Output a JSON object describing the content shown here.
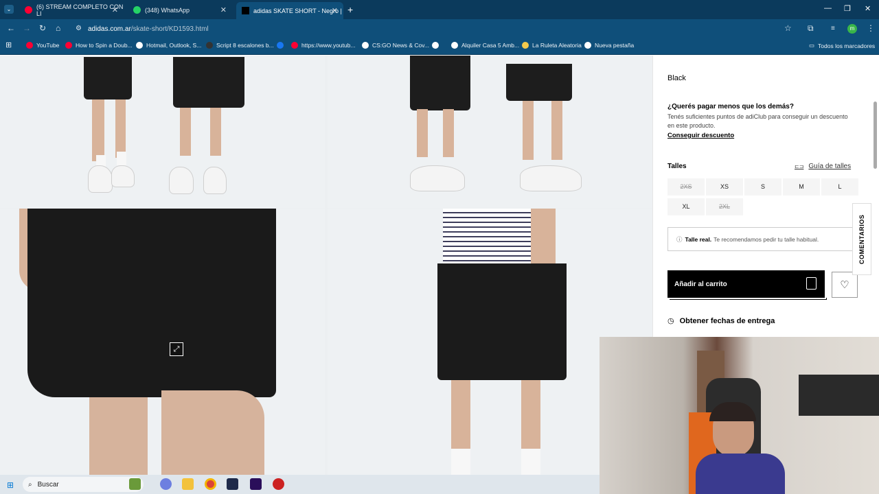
{
  "browser": {
    "tabs": [
      {
        "title": "(6) STREAM COMPLETO CON LI",
        "favicon_color": "#ff0033"
      },
      {
        "title": "(348) WhatsApp",
        "favicon_color": "#25d366"
      },
      {
        "title": "adidas SKATE SHORT - Negro |",
        "favicon_color": "#000000"
      }
    ],
    "url_domain": "adidas.com.ar",
    "url_path": "/skate-short/KD1593.html",
    "bookmarks": [
      {
        "label": "YouTube",
        "color": "#ff0033"
      },
      {
        "label": "How to Spin a Doub...",
        "color": "#ff0033"
      },
      {
        "label": "Hotmail, Outlook, S...",
        "color": "#ffffff"
      },
      {
        "label": "Script 8 escalones b...",
        "color": "#333333"
      },
      {
        "label": "",
        "color": "#1877f2"
      },
      {
        "label": "https://www.youtub...",
        "color": "#ff0033"
      },
      {
        "label": "CS:GO News & Cov...",
        "color": "#ffffff"
      },
      {
        "label": "",
        "color": "#ffffff"
      },
      {
        "label": "Alquiler Casa 5 Amb...",
        "color": "#ffffff"
      },
      {
        "label": "La Ruleta Aleatoria",
        "color": "#f2c94c"
      },
      {
        "label": "Nueva pestaña",
        "color": "#ffffff"
      }
    ],
    "all_bookmarks": "Todos los marcadores",
    "profile_initial": "m"
  },
  "product": {
    "color_name": "Black",
    "promo_title": "¿Querés pagar menos que los demás?",
    "promo_desc": "Tenés suficientes puntos de adiClub para conseguir un descuento en este producto.",
    "promo_link": "Conseguir descuento",
    "sizes_title": "Talles",
    "size_guide": "Guía de talles",
    "sizes": [
      {
        "label": "2XS",
        "available": false
      },
      {
        "label": "XS",
        "available": true
      },
      {
        "label": "S",
        "available": true
      },
      {
        "label": "M",
        "available": true
      },
      {
        "label": "L",
        "available": true
      },
      {
        "label": "XL",
        "available": true
      },
      {
        "label": "2XL",
        "available": false
      }
    ],
    "fit_note_bold": "Talle real.",
    "fit_note": "Te recomendamos pedir tu talle habitual.",
    "add_to_cart": "Añadir al carrito",
    "delivery": "Obtener fechas de entrega",
    "comments_tab": "COMENTARIOS"
  },
  "taskbar": {
    "search_placeholder": "Buscar"
  }
}
